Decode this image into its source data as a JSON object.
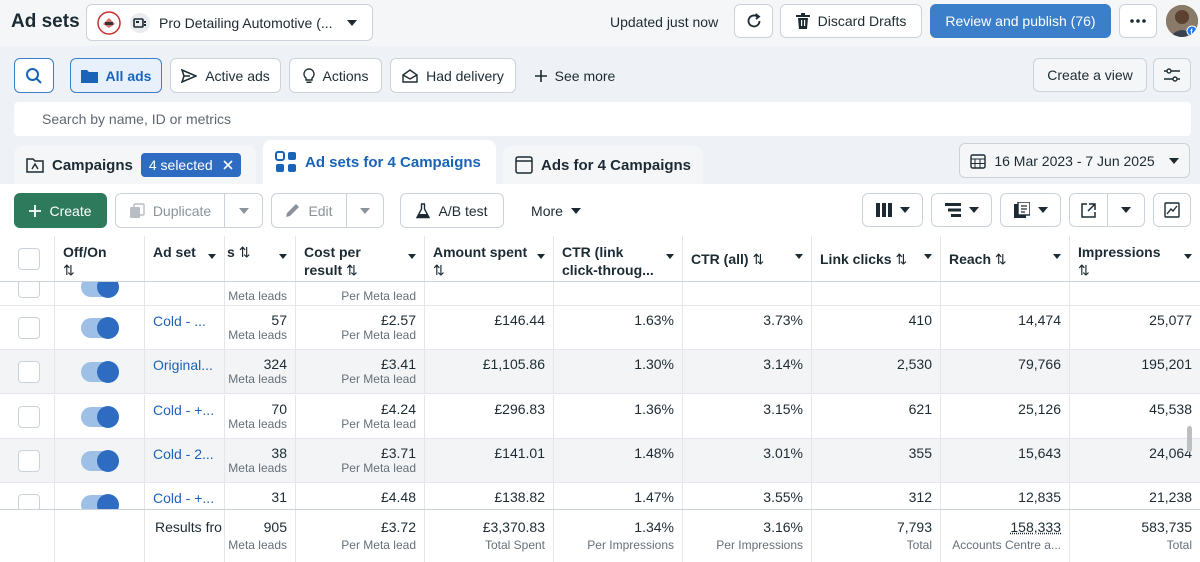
{
  "header": {
    "title": "Ad sets",
    "account_name": "Pro Detailing Automotive (...",
    "updated_text": "Updated just now",
    "discard_label": "Discard Drafts",
    "publish_label": "Review and publish (76)"
  },
  "filters": {
    "all_ads": "All ads",
    "active_ads": "Active ads",
    "actions": "Actions",
    "had_delivery": "Had delivery",
    "see_more": "See more",
    "create_view": "Create a view"
  },
  "search": {
    "placeholder": "Search by name, ID or metrics"
  },
  "level_tabs": {
    "campaigns": "Campaigns",
    "selected_badge": "4 selected",
    "adsets": "Ad sets for 4 Campaigns",
    "ads": "Ads for 4 Campaigns"
  },
  "date_range": "16 Mar 2023 - 7 Jun 2025",
  "toolbar": {
    "create": "Create",
    "duplicate": "Duplicate",
    "edit": "Edit",
    "ab_test": "A/B test",
    "more": "More"
  },
  "columns": {
    "off_on": "Off/On",
    "ad_set": "Ad set",
    "results": "s",
    "cost_per_result_1": "Cost per",
    "cost_per_result_2": "result",
    "amount_spent": "Amount spent",
    "ctr_link_1": "CTR (link",
    "ctr_link_2": "click-throug...",
    "ctr_all": "CTR (all)",
    "link_clicks": "Link clicks",
    "reach": "Reach",
    "impressions": "Impressions"
  },
  "partial_row": {
    "results_sub": "Meta leads",
    "cost_sub": "Per Meta lead"
  },
  "rows": [
    {
      "name": "Cold - ...",
      "results": "57",
      "results_sub": "Meta leads",
      "cost": "£2.57",
      "cost_sub": "Per Meta lead",
      "spent": "£146.44",
      "ctr_link": "1.63%",
      "ctr_all": "3.73%",
      "link_clicks": "410",
      "reach": "14,474",
      "impressions": "25,077"
    },
    {
      "name": "Original...",
      "results": "324",
      "results_sub": "Meta leads",
      "cost": "£3.41",
      "cost_sub": "Per Meta lead",
      "spent": "£1,105.86",
      "ctr_link": "1.30%",
      "ctr_all": "3.14%",
      "link_clicks": "2,530",
      "reach": "79,766",
      "impressions": "195,201"
    },
    {
      "name": "Cold - +...",
      "results": "70",
      "results_sub": "Meta leads",
      "cost": "£4.24",
      "cost_sub": "Per Meta lead",
      "spent": "£296.83",
      "ctr_link": "1.36%",
      "ctr_all": "3.15%",
      "link_clicks": "621",
      "reach": "25,126",
      "impressions": "45,538"
    },
    {
      "name": "Cold - 2...",
      "results": "38",
      "results_sub": "Meta leads",
      "cost": "£3.71",
      "cost_sub": "Per Meta lead",
      "spent": "£141.01",
      "ctr_link": "1.48%",
      "ctr_all": "3.01%",
      "link_clicks": "355",
      "reach": "15,643",
      "impressions": "24,064"
    },
    {
      "name": "Cold - +...",
      "results": "31",
      "results_sub": "",
      "cost": "£4.48",
      "cost_sub": "",
      "spent": "£138.82",
      "ctr_link": "1.47%",
      "ctr_all": "3.55%",
      "link_clicks": "312",
      "reach": "12,835",
      "impressions": "21,238"
    }
  ],
  "totals": {
    "label": "Results fro",
    "results": "905",
    "results_sub": "Meta leads",
    "cost": "£3.72",
    "cost_sub": "Per Meta lead",
    "spent": "£3,370.83",
    "spent_sub": "Total Spent",
    "ctr_link": "1.34%",
    "ctr_link_sub": "Per Impressions",
    "ctr_all": "3.16%",
    "ctr_all_sub": "Per Impressions",
    "link_clicks": "7,793",
    "link_clicks_sub": "Total",
    "reach": "158,333",
    "reach_sub": "Accounts Centre a...",
    "impressions": "583,735",
    "impressions_sub": "Total"
  },
  "colors": {
    "primary_blue": "#3b7fcb",
    "create_green": "#2d7a5c",
    "link_blue": "#1a64b8"
  }
}
